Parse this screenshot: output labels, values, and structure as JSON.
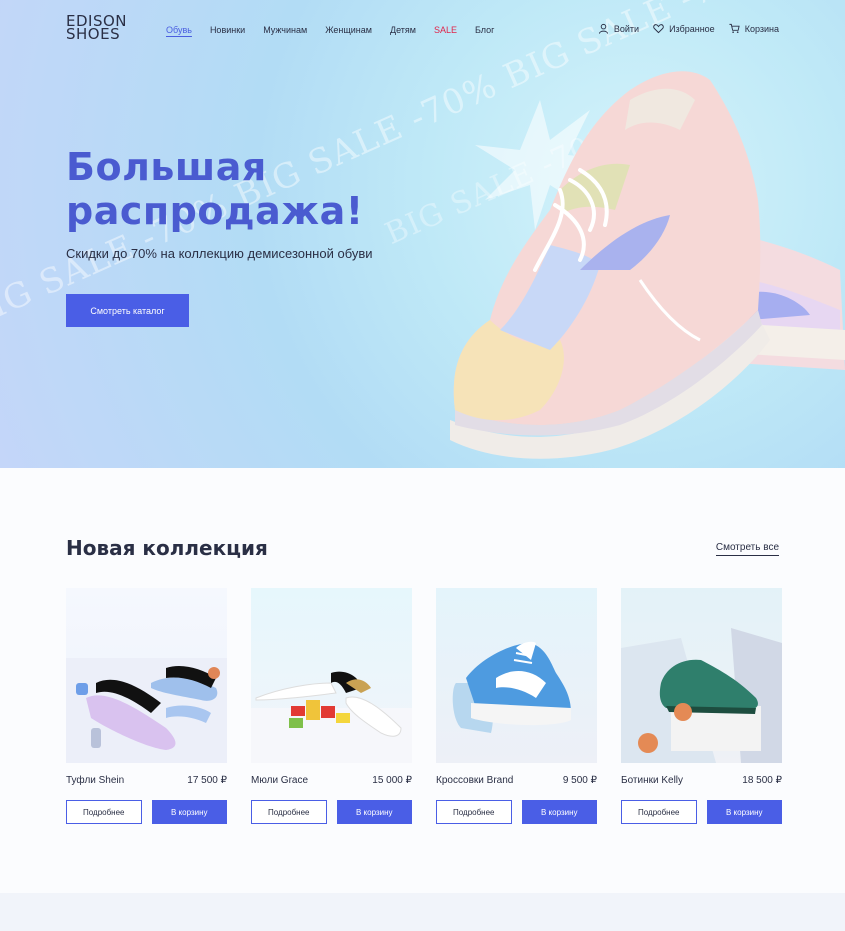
{
  "logo": {
    "line1": "EDISON",
    "line2": "SHOES"
  },
  "nav": [
    "Обувь",
    "Новинки",
    "Мужчинам",
    "Женщинам",
    "Детям",
    "SALE",
    "Блог"
  ],
  "header_actions": {
    "login": "Войти",
    "favorites": "Избранное",
    "cart": "Корзина"
  },
  "hero": {
    "title_line1": "Большая",
    "title_line2": "распродажа!",
    "subtitle": "Скидки до 70% на коллекцию демисезонной обуви",
    "button": "Смотреть каталог",
    "watermark": "BIG SALE -70% BIG SALE -70% BIG SALE -70% BIG SALE",
    "watermark2": "BIG SALE -70% BIG S"
  },
  "collection": {
    "title": "Новая коллекция",
    "see_all": "Смотреть все",
    "details_label": "Подробнее",
    "cart_label": "В корзину",
    "products": [
      {
        "name": "Туфли Shein",
        "price": "17 500 ₽"
      },
      {
        "name": "Мюли Grace",
        "price": "15 000 ₽"
      },
      {
        "name": "Кроссовки Brand",
        "price": "9 500 ₽"
      },
      {
        "name": "Ботинки Kelly",
        "price": "18 500 ₽"
      }
    ]
  },
  "colors": {
    "accent": "#4a5ee6",
    "sale": "#e0244a",
    "text": "#2a2f45"
  }
}
